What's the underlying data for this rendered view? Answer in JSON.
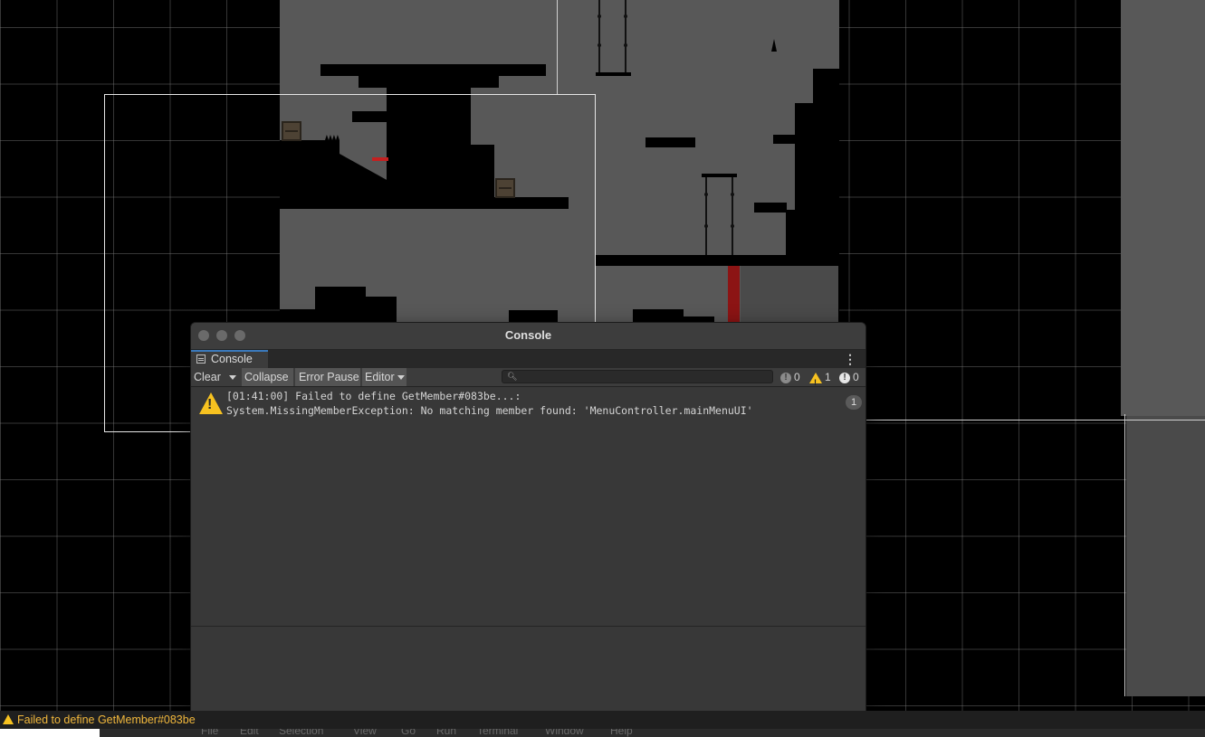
{
  "console_window": {
    "title": "Console",
    "tab_label": "Console",
    "toolbar": {
      "clear_label": "Clear",
      "collapse_label": "Collapse",
      "error_pause_label": "Error Pause",
      "editor_label": "Editor",
      "search_placeholder": "",
      "info_count": "0",
      "warning_count": "1",
      "error_count": "0"
    },
    "log_entries": [
      {
        "type": "warning",
        "line1": "[01:41:00] Failed to define GetMember#083be...:",
        "line2": "System.MissingMemberException: No matching member found: 'MenuController.mainMenuUI'",
        "count": "1"
      }
    ]
  },
  "status_bar": {
    "message": "Failed to define GetMember#083be"
  },
  "menu_bar": {
    "items": [
      "File",
      "Edit",
      "Selection",
      "View",
      "Go",
      "Run",
      "Terminal",
      "Window",
      "Help"
    ]
  },
  "colors": {
    "warning": "#f7c220",
    "accent_tab": "#3a79bb",
    "red_hazard": "#8c1414"
  },
  "icons": [
    "warning-icon",
    "info-icon",
    "error-icon",
    "search-icon",
    "kebab-menu-icon",
    "console-tab-icon"
  ]
}
